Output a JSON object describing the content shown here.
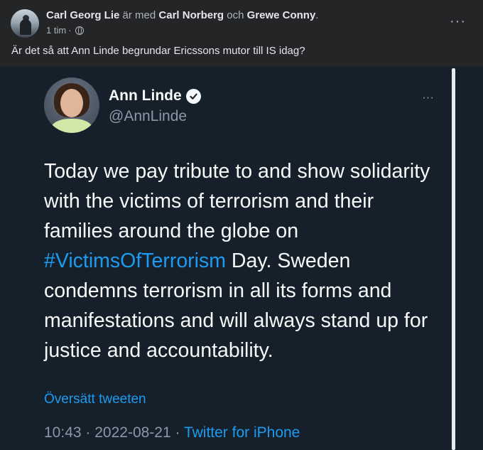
{
  "post": {
    "author": "Carl Georg Lie",
    "with_text": "är med",
    "tagged_1": "Carl Norberg",
    "and_text": "och",
    "tagged_2": "Grewe Conny",
    "period": ".",
    "time": "1 tim",
    "dot": "·",
    "more": "···",
    "text": "Är det så att Ann Linde begrundar Ericssons mutor till IS idag?"
  },
  "tweet": {
    "name": "Ann Linde",
    "handle": "@AnnLinde",
    "more": "···",
    "body_part1": "Today we pay tribute to and show solidarity with the victims of terrorism and their families around the globe on ",
    "hashtag": "#VictimsOfTerrorism",
    "body_part2": " Day. Sweden condemns terrorism in all its forms and manifestations and will always stand up for justice and accountability.",
    "translate": "Översätt tweeten",
    "time": "10:43",
    "sep1": " · ",
    "date": "2022-08-21",
    "sep2": " · ",
    "source": "Twitter for iPhone"
  },
  "colors": {
    "fb_bg": "#242526",
    "tweet_bg": "#15202b",
    "link": "#1d9bf0"
  }
}
